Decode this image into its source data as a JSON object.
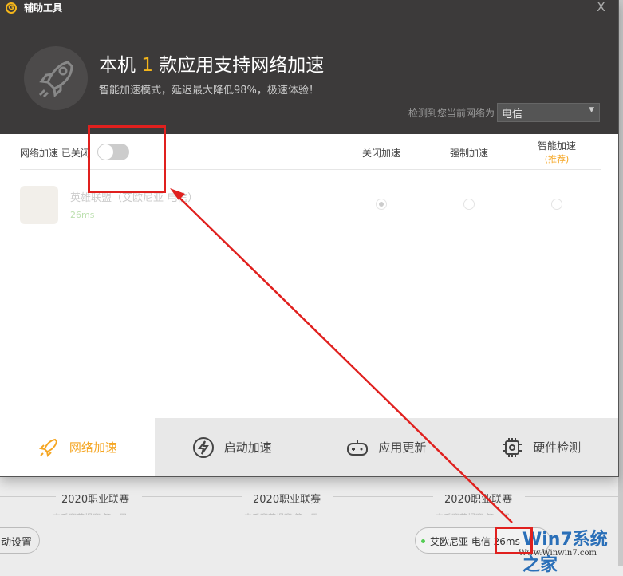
{
  "window": {
    "title": "辅助工具",
    "logo": "G",
    "close": "X"
  },
  "header": {
    "title_pre": "本机",
    "count": "1",
    "title_post": "款应用支持网络加速",
    "subtitle": "智能加速模式，延迟最大降低98%，极速体验！",
    "network_label": "检测到您当前网络为",
    "network_value": "电信"
  },
  "table": {
    "toggle_label": "网络加速 已关闭",
    "cols": [
      "关闭加速",
      "强制加速",
      "智能加速"
    ],
    "recommend": "(推荐)",
    "rows": [
      {
        "name": "英雄联盟（艾欧尼亚 电信）",
        "latency": "26ms",
        "selected": 0
      }
    ]
  },
  "tabs": [
    {
      "label": "网络加速",
      "active": true
    },
    {
      "label": "启动加速"
    },
    {
      "label": "应用更新"
    },
    {
      "label": "硬件检测"
    }
  ],
  "background": {
    "leagues": [
      "2020职业联赛",
      "2020职业联赛",
      "2020职业联赛"
    ],
    "sub": "丰禾赛营报赛 第一周",
    "settings_btn": "动设置",
    "server_pill": "艾欧尼亚 电信 26ms"
  },
  "watermark": {
    "brand": "Win7系统之家",
    "url": "Www.Winwin7.com"
  },
  "colors": {
    "accent": "#f5a623",
    "annotation": "#e0201e"
  }
}
